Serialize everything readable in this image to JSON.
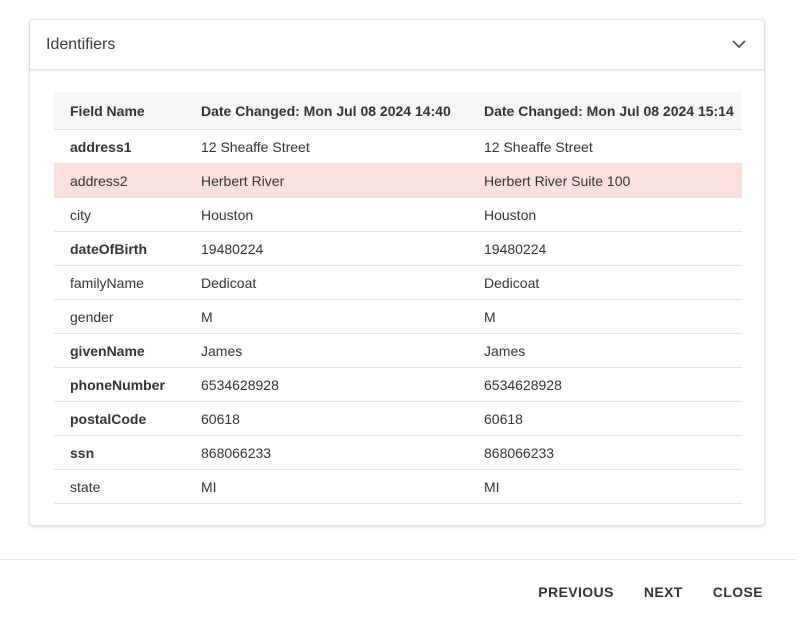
{
  "panel": {
    "title": "Identifiers",
    "toggle_icon": "chevron-down-icon"
  },
  "table": {
    "headers": [
      "Field Name",
      "Date Changed: Mon Jul 08 2024 14:40",
      "Date Changed: Mon Jul 08 2024 15:14"
    ],
    "rows": [
      {
        "field": "address1",
        "old": "12 Sheaffe Street",
        "new": "12 Sheaffe Street",
        "bold": true,
        "changed": false
      },
      {
        "field": "address2",
        "old": "Herbert River",
        "new": "Herbert River Suite 100",
        "bold": false,
        "changed": true
      },
      {
        "field": "city",
        "old": "Houston",
        "new": "Houston",
        "bold": false,
        "changed": false
      },
      {
        "field": "dateOfBirth",
        "old": "19480224",
        "new": "19480224",
        "bold": true,
        "changed": false
      },
      {
        "field": "familyName",
        "old": "Dedicoat",
        "new": "Dedicoat",
        "bold": false,
        "changed": false
      },
      {
        "field": "gender",
        "old": "M",
        "new": "M",
        "bold": false,
        "changed": false
      },
      {
        "field": "givenName",
        "old": "James",
        "new": "James",
        "bold": true,
        "changed": false
      },
      {
        "field": "phoneNumber",
        "old": "6534628928",
        "new": "6534628928",
        "bold": true,
        "changed": false
      },
      {
        "field": "postalCode",
        "old": "60618",
        "new": "60618",
        "bold": true,
        "changed": false
      },
      {
        "field": "ssn",
        "old": "868066233",
        "new": "868066233",
        "bold": true,
        "changed": false
      },
      {
        "field": "state",
        "old": "MI",
        "new": "MI",
        "bold": false,
        "changed": false
      }
    ],
    "changed_row_color": "#fbe0e0"
  },
  "footer": {
    "previous_label": "PREVIOUS",
    "next_label": "NEXT",
    "close_label": "CLOSE"
  }
}
